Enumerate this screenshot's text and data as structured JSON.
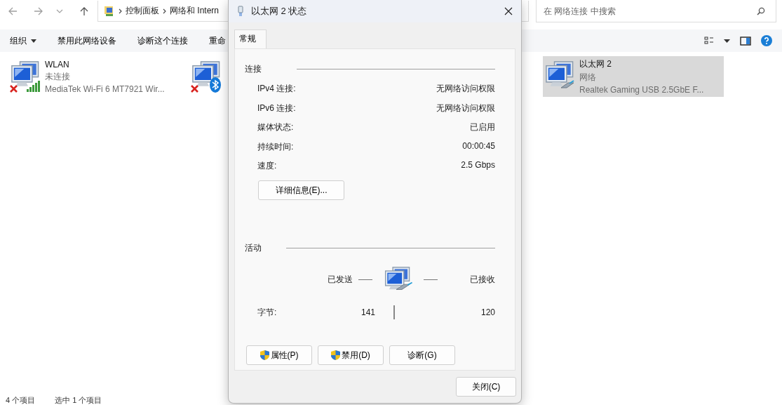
{
  "breadcrumb": [
    "控制面板",
    "网络和 Intern"
  ],
  "search": {
    "placeholder": "在 网络连接 中搜索"
  },
  "toolbar": [
    {
      "label": "组织",
      "dropdown": true
    },
    {
      "label": "禁用此网络设备",
      "dropdown": false
    },
    {
      "label": "诊断这个连接",
      "dropdown": false
    },
    {
      "label": "重命",
      "dropdown": false
    }
  ],
  "adapters": [
    {
      "kind": "wifi",
      "name": "WLAN",
      "status": "未连接",
      "device": "MediaTek Wi-Fi 6 MT7921 Wir...",
      "disconnected": true,
      "selected": false
    },
    {
      "kind": "bluetooth",
      "disconnected": true,
      "selected": false
    },
    {
      "kind": "ethernet",
      "name": "以太网 2",
      "status": "网络",
      "device": "Realtek Gaming USB 2.5GbE F...",
      "disconnected": false,
      "selected": true
    }
  ],
  "status_bar": [
    "4 个项目",
    "选中 1 个项目"
  ],
  "dialog": {
    "title": "以太网 2 状态",
    "tabs": [
      {
        "label": "常规",
        "selected": true
      }
    ],
    "connection": {
      "heading": "连接",
      "rows": [
        {
          "label": "IPv4 连接:",
          "value": "无网络访问权限"
        },
        {
          "label": "IPv6 连接:",
          "value": "无网络访问权限"
        },
        {
          "label": "媒体状态:",
          "value": "已启用"
        },
        {
          "label": "持续时间:",
          "value": "00:00:45"
        },
        {
          "label": "速度:",
          "value": "2.5 Gbps"
        }
      ]
    },
    "details_button": "详细信息(E)...",
    "activity": {
      "heading": "活动",
      "sent": "已发送",
      "received": "已接收",
      "bytes_label": "字节:",
      "bytes_sent": "141",
      "bytes_received": "120"
    },
    "buttons": [
      {
        "label": "属性(P)",
        "shield": true
      },
      {
        "label": "禁用(D)",
        "shield": true
      },
      {
        "label": "诊断(G)",
        "shield": false
      }
    ],
    "close_button": "关闭(C)"
  }
}
